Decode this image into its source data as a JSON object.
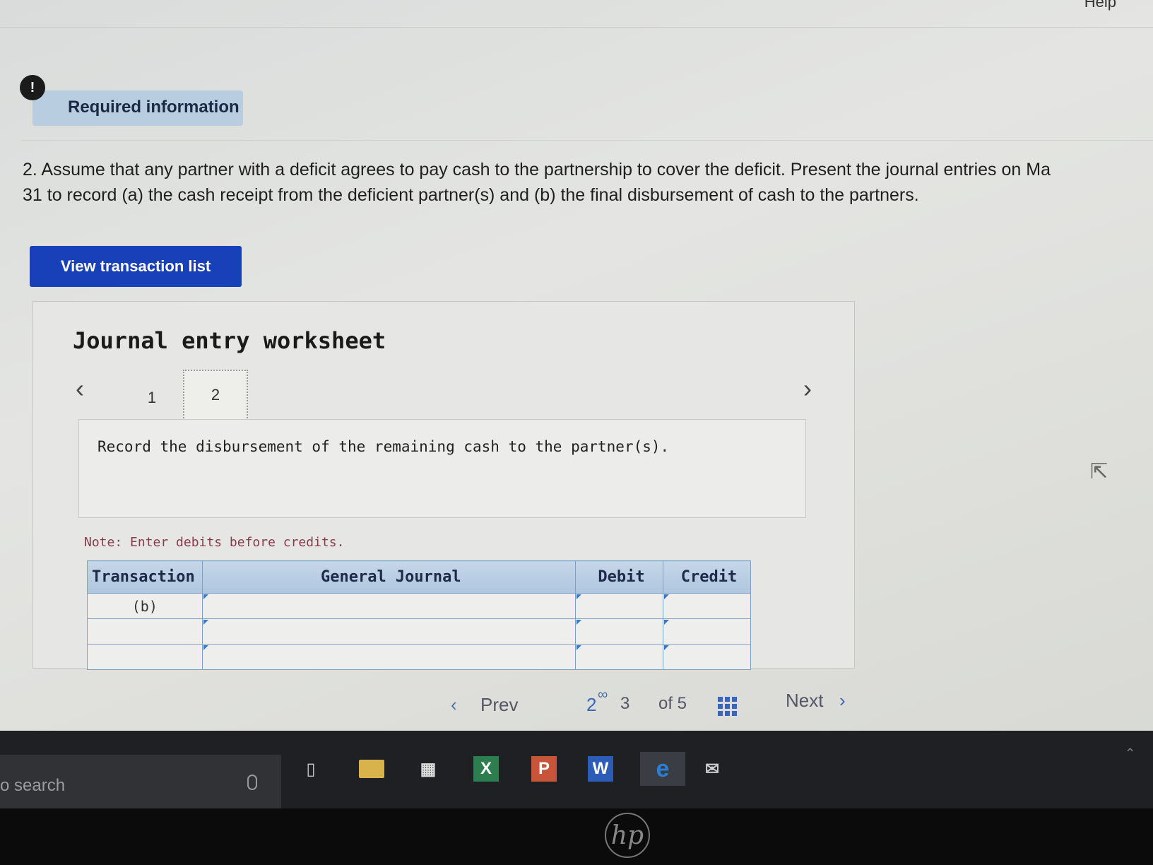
{
  "header": {
    "help_label": "Help"
  },
  "alert": {
    "icon_text": "!",
    "label": "Required information"
  },
  "question": {
    "line1": "2. Assume that any partner with a deficit agrees to pay cash to the partnership to cover the deficit. Present the journal entries on Ma",
    "line2": "31 to record (a) the cash receipt from the deficient partner(s) and (b) the final disbursement of cash to the partners."
  },
  "view_button": "View transaction list",
  "worksheet": {
    "title": "Journal entry worksheet",
    "tabs": [
      {
        "label": "1"
      },
      {
        "label": "2"
      }
    ],
    "active_tab": "2",
    "instruction": "Record the disbursement of the remaining cash to the partner(s).",
    "note": "Note: Enter debits before credits.",
    "table": {
      "headers": {
        "transaction": "Transaction",
        "journal": "General Journal",
        "debit": "Debit",
        "credit": "Credit"
      },
      "rows": [
        {
          "transaction": "(b)",
          "journal": "",
          "debit": "",
          "credit": ""
        },
        {
          "transaction": "",
          "journal": "",
          "debit": "",
          "credit": ""
        },
        {
          "transaction": "",
          "journal": "",
          "debit": "",
          "credit": ""
        }
      ]
    }
  },
  "pager": {
    "prev": "Prev",
    "page_a": "2",
    "page_b": "3",
    "of_total": "of 5",
    "next": "Next"
  },
  "taskbar": {
    "search_text": "o search",
    "apps": [
      {
        "name": "excel",
        "letter": "X",
        "color": "#2e7d4f"
      },
      {
        "name": "powerpoint",
        "letter": "P",
        "color": "#c8553a"
      },
      {
        "name": "word",
        "letter": "W",
        "color": "#2b5cb8"
      },
      {
        "name": "edge",
        "letter": "e",
        "color": "#2a7fd4"
      }
    ]
  },
  "bezel": {
    "logo": "hp"
  }
}
